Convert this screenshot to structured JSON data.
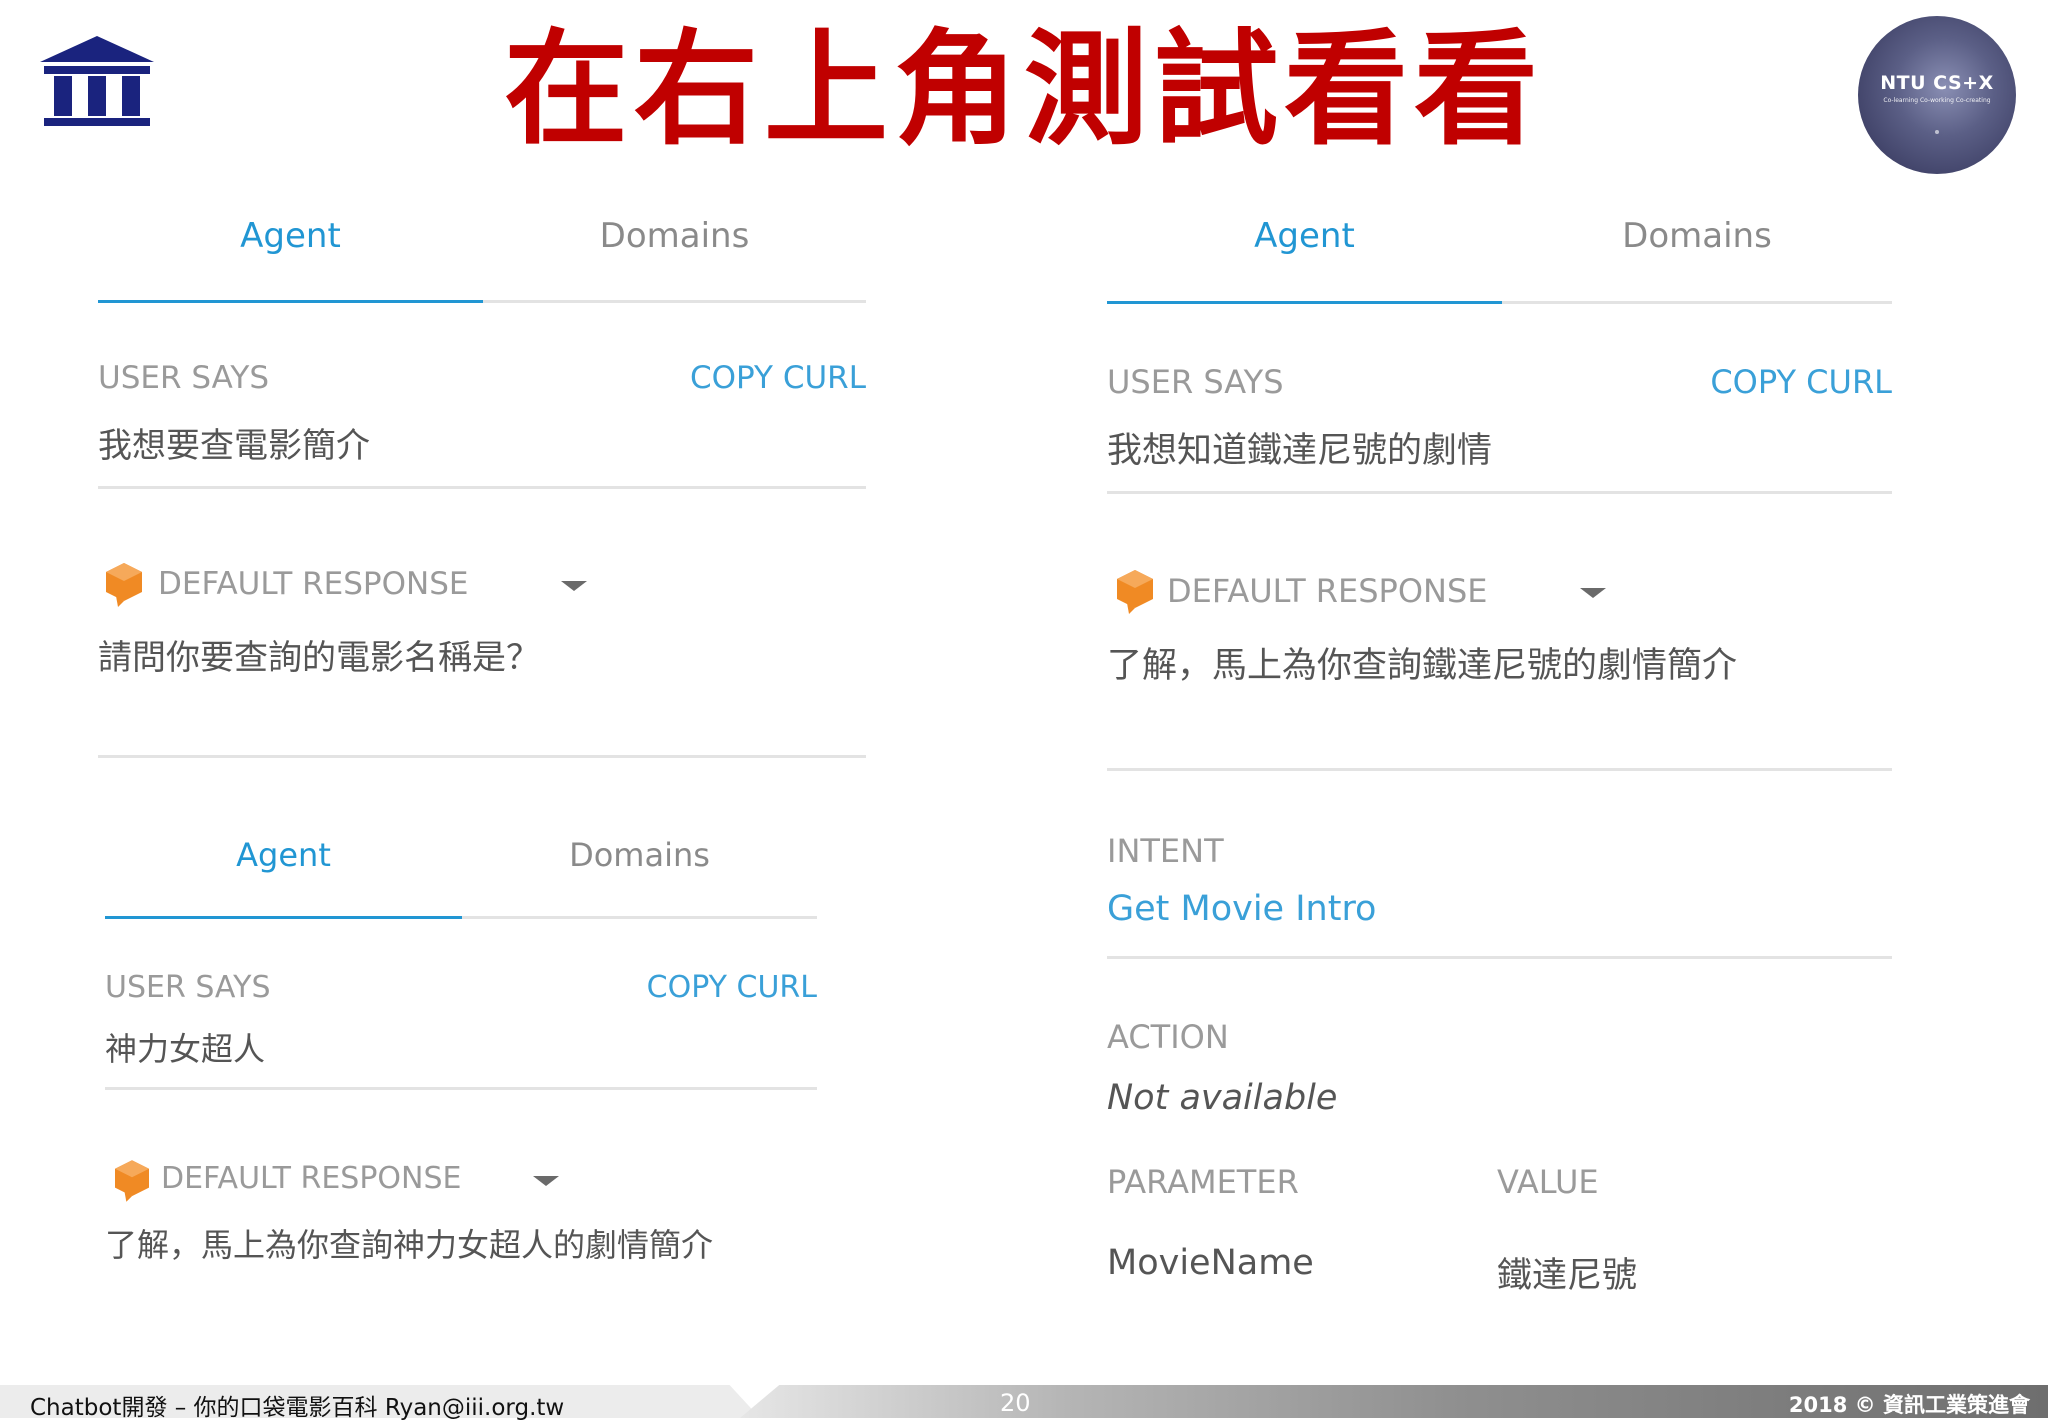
{
  "slide": {
    "title": "在右上角測試看看",
    "badge": {
      "line1": "NTU CS+X",
      "line2": "Co-learning Co-working Co-creating"
    },
    "page_number": "20",
    "footer_left": "Chatbot開發 – 你的口袋電影百科 Ryan@iii.org.tw",
    "footer_right": "2018 © 資訊工業策進會"
  },
  "colors": {
    "title": "#c00000",
    "accent": "#2196d3",
    "response_icon": "#f08a24"
  },
  "panel_top_left": {
    "tabs": [
      {
        "label": "Agent"
      },
      {
        "label": "Domains"
      }
    ],
    "user_says_label": "USER SAYS",
    "copy_curl": "COPY CURL",
    "user_says_value": "我想要查電影簡介",
    "response_label": "DEFAULT RESPONSE",
    "response_text": "請問你要查詢的電影名稱是？"
  },
  "panel_bottom_left": {
    "tabs": [
      {
        "label": "Agent"
      },
      {
        "label": "Domains"
      }
    ],
    "user_says_label": "USER SAYS",
    "copy_curl": "COPY CURL",
    "user_says_value": "神力女超人",
    "response_label": "DEFAULT RESPONSE",
    "response_text": "了解，馬上為你查詢神力女超人的劇情簡介"
  },
  "panel_right": {
    "tabs": [
      {
        "label": "Agent"
      },
      {
        "label": "Domains"
      }
    ],
    "user_says_label": "USER SAYS",
    "copy_curl": "COPY CURL",
    "user_says_value": "我想知道鐵達尼號的劇情",
    "response_label": "DEFAULT RESPONSE",
    "response_text": "了解，馬上為你查詢鐵達尼號的劇情簡介",
    "intent_label": "INTENT",
    "intent_value": "Get Movie Intro",
    "action_label": "ACTION",
    "action_value": "Not available",
    "parameter_header": "PARAMETER",
    "value_header": "VALUE",
    "parameters": [
      {
        "name": "MovieName",
        "value": "鐵達尼號"
      }
    ]
  }
}
